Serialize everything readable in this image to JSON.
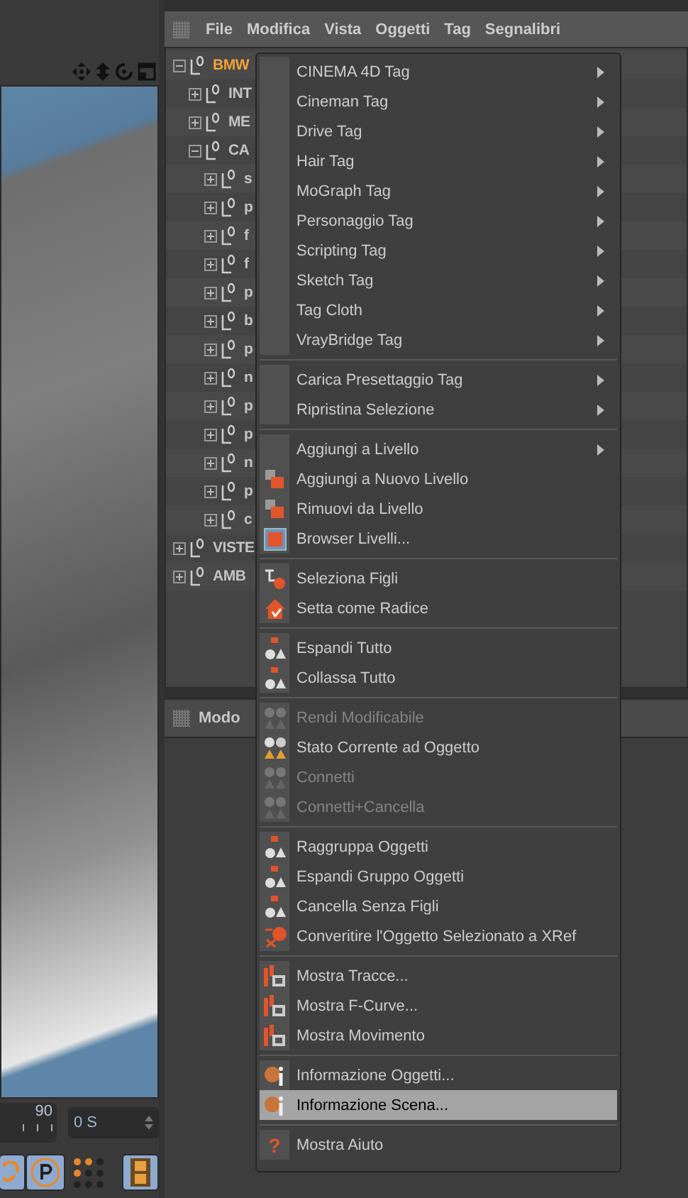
{
  "viewport": {
    "timeline": {
      "end_label": "90"
    },
    "time_field": {
      "value": "0 S"
    }
  },
  "outliner": {
    "menu": [
      "File",
      "Modifica",
      "Vista",
      "Oggetti",
      "Tag",
      "Segnalibri"
    ],
    "tree": [
      {
        "label": "BMW",
        "selected": true,
        "expanded": true,
        "children": [
          {
            "label": "INT",
            "selected": false,
            "expanded": false
          },
          {
            "label": "ME",
            "selected": false,
            "expanded": false
          },
          {
            "label": "CA",
            "selected": false,
            "expanded": true,
            "children": [
              {
                "label": "s",
                "selected": false,
                "expanded": false
              },
              {
                "label": "p",
                "selected": false,
                "expanded": false
              },
              {
                "label": "f",
                "selected": false,
                "expanded": false
              },
              {
                "label": "f",
                "selected": false,
                "expanded": false
              },
              {
                "label": "p",
                "selected": false,
                "expanded": false
              },
              {
                "label": "b",
                "selected": false,
                "expanded": false
              },
              {
                "label": "p",
                "selected": false,
                "expanded": false
              },
              {
                "label": "n",
                "selected": false,
                "expanded": false
              },
              {
                "label": "p",
                "selected": false,
                "expanded": false
              },
              {
                "label": "p",
                "selected": false,
                "expanded": false
              },
              {
                "label": "n",
                "selected": false,
                "expanded": false
              },
              {
                "label": "p",
                "selected": false,
                "expanded": false
              },
              {
                "label": "c",
                "selected": false,
                "expanded": false
              }
            ]
          }
        ]
      },
      {
        "label": "VISTE",
        "selected": false,
        "expanded": false
      },
      {
        "label": "AMB",
        "selected": false,
        "expanded": false
      }
    ],
    "mode_bar": {
      "label": "Modo"
    }
  },
  "context_menu": {
    "sections": [
      {
        "items": [
          {
            "label": "CINEMA 4D Tag",
            "submenu": true,
            "disabled": false,
            "selected": false
          },
          {
            "label": "Cineman Tag",
            "submenu": true,
            "disabled": false,
            "selected": false
          },
          {
            "label": "Drive Tag",
            "submenu": true,
            "disabled": false,
            "selected": false
          },
          {
            "label": "Hair Tag",
            "submenu": true,
            "disabled": false,
            "selected": false
          },
          {
            "label": "MoGraph Tag",
            "submenu": true,
            "disabled": false,
            "selected": false
          },
          {
            "label": "Personaggio Tag",
            "submenu": true,
            "disabled": false,
            "selected": false
          },
          {
            "label": "Scripting Tag",
            "submenu": true,
            "disabled": false,
            "selected": false
          },
          {
            "label": "Sketch Tag",
            "submenu": true,
            "disabled": false,
            "selected": false
          },
          {
            "label": "Tag Cloth",
            "submenu": true,
            "disabled": false,
            "selected": false
          },
          {
            "label": "VrayBridge Tag",
            "submenu": true,
            "disabled": false,
            "selected": false
          }
        ]
      },
      {
        "items": [
          {
            "label": "Carica Presettaggio Tag",
            "submenu": true,
            "disabled": false,
            "selected": false
          },
          {
            "label": "Ripristina Selezione",
            "submenu": true,
            "disabled": false,
            "selected": false
          }
        ]
      },
      {
        "items": [
          {
            "label": "Aggiungi a Livello",
            "submenu": true,
            "disabled": false,
            "selected": false
          },
          {
            "label": "Aggiungi a Nuovo Livello",
            "kind": "layers",
            "submenu": false,
            "disabled": false,
            "selected": false
          },
          {
            "label": "Rimuovi da Livello",
            "kind": "layers",
            "submenu": false,
            "disabled": false,
            "selected": false
          },
          {
            "label": "Browser Livelli...",
            "kind": "browser",
            "submenu": false,
            "disabled": false,
            "selected": false
          }
        ]
      },
      {
        "items": [
          {
            "label": "Seleziona Figli",
            "kind": "hierarchy",
            "submenu": false,
            "disabled": false,
            "selected": false
          },
          {
            "label": "Setta come Radice",
            "kind": "house",
            "submenu": false,
            "disabled": false,
            "selected": false
          }
        ]
      },
      {
        "items": [
          {
            "label": "Espandi Tutto",
            "kind": "object-group",
            "submenu": false,
            "disabled": false,
            "selected": false
          },
          {
            "label": "Collassa Tutto",
            "kind": "object-group",
            "submenu": false,
            "disabled": false,
            "selected": false
          }
        ]
      },
      {
        "items": [
          {
            "label": "Rendi Modificabile",
            "kind": "shapes",
            "submenu": false,
            "disabled": true,
            "selected": false
          },
          {
            "label": "Stato Corrente ad Oggetto",
            "kind": "shapes",
            "submenu": false,
            "disabled": false,
            "selected": false
          },
          {
            "label": "Connetti",
            "kind": "shapes",
            "submenu": false,
            "disabled": true,
            "selected": false
          },
          {
            "label": "Connetti+Cancella",
            "kind": "shapes",
            "submenu": false,
            "disabled": true,
            "selected": false
          }
        ]
      },
      {
        "items": [
          {
            "label": "Raggruppa Oggetti",
            "kind": "object-group",
            "submenu": false,
            "disabled": false,
            "selected": false
          },
          {
            "label": "Espandi Gruppo Oggetti",
            "kind": "object-group",
            "submenu": false,
            "disabled": false,
            "selected": false
          },
          {
            "label": "Cancella Senza Figli",
            "kind": "object-group",
            "submenu": false,
            "disabled": false,
            "selected": false
          },
          {
            "label": "Converitire l'Oggetto Selezionato a XRef",
            "kind": "sphere",
            "submenu": false,
            "disabled": false,
            "selected": false
          }
        ]
      },
      {
        "items": [
          {
            "label": "Mostra Tracce...",
            "kind": "graph",
            "submenu": false,
            "disabled": false,
            "selected": false
          },
          {
            "label": "Mostra F-Curve...",
            "kind": "graph",
            "submenu": false,
            "disabled": false,
            "selected": false
          },
          {
            "label": "Mostra Movimento",
            "kind": "graph",
            "submenu": false,
            "disabled": false,
            "selected": false
          }
        ]
      },
      {
        "items": [
          {
            "label": "Informazione Oggetti...",
            "kind": "info",
            "submenu": false,
            "disabled": false,
            "selected": false
          },
          {
            "label": "Informazione Scena...",
            "kind": "info",
            "submenu": false,
            "disabled": false,
            "selected": true
          }
        ]
      },
      {
        "items": [
          {
            "label": "Mostra Aiuto",
            "kind": "help",
            "glyph": "?",
            "submenu": false,
            "disabled": false,
            "selected": false
          }
        ]
      }
    ]
  }
}
